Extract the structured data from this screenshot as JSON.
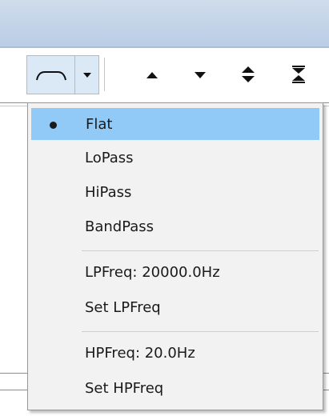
{
  "toolbar": {
    "buttons": [
      {
        "name": "filter-curve",
        "icon": "flat-curve-icon"
      },
      {
        "name": "dropdown",
        "icon": "chevron-down-icon"
      },
      {
        "name": "move-up",
        "icon": "triangle-up-icon"
      },
      {
        "name": "move-down",
        "icon": "triangle-down-icon"
      },
      {
        "name": "expand",
        "icon": "expand-vertical-icon"
      },
      {
        "name": "collapse",
        "icon": "collapse-vertical-icon"
      }
    ]
  },
  "menu": {
    "selected": "Flat",
    "filter_types": [
      "Flat",
      "LoPass",
      "HiPass",
      "BandPass"
    ],
    "lp_freq": "LPFreq: 20000.0Hz",
    "set_lp": "Set LPFreq",
    "hp_freq": "HPFreq: 20.0Hz",
    "set_hp": "Set HPFreq"
  },
  "colors": {
    "selection": "#91c9f7",
    "menu_bg": "#f2f2f2",
    "header": "#b9cde5"
  }
}
